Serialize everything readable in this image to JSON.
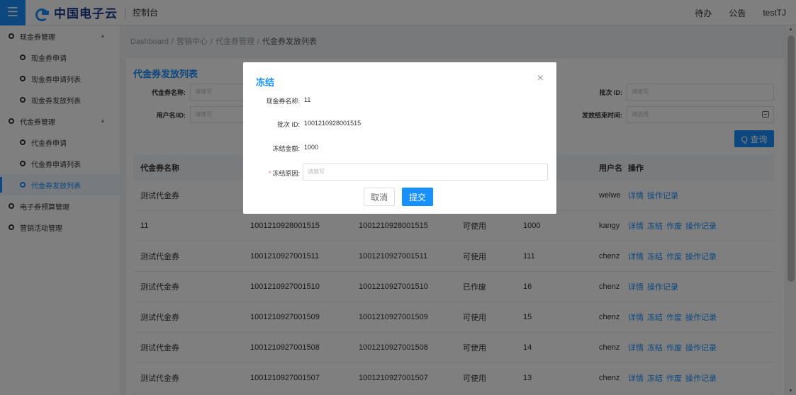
{
  "topbar": {
    "logo": "中国电子云",
    "title": "控制台",
    "todo": "待办",
    "notice": "公告",
    "user": "testTJ"
  },
  "sidebar": {
    "items": [
      {
        "label": "现金券管理",
        "level": 1,
        "caret": "▲",
        "active": false
      },
      {
        "label": "现金券申请",
        "level": 2,
        "active": false
      },
      {
        "label": "现金券申请列表",
        "level": 2,
        "active": false
      },
      {
        "label": "现金券发放列表",
        "level": 2,
        "active": false
      },
      {
        "label": "代金券管理",
        "level": 1,
        "caret": "▲",
        "active": false
      },
      {
        "label": "代金券申请",
        "level": 2,
        "active": false
      },
      {
        "label": "代金券申请列表",
        "level": 2,
        "active": false
      },
      {
        "label": "代金券发放列表",
        "level": 2,
        "active": true
      },
      {
        "label": "电子券预算管理",
        "level": 1,
        "active": false
      },
      {
        "label": "营销活动管理",
        "level": 1,
        "active": false
      }
    ]
  },
  "breadcrumb": [
    "Dashboard",
    "营销中心",
    "代金券管理",
    "代金券发放列表"
  ],
  "breadcrumb_sep": "/",
  "panel": {
    "title": "代金券发放列表",
    "filters": {
      "name_label": "代金券名称:",
      "name_placeholder": "请填写",
      "user_label": "用户名/ID:",
      "user_placeholder": "请填写",
      "batch_label": "批次 ID:",
      "batch_placeholder": "请填写",
      "end_label": "发放结束时间:",
      "end_placeholder": "请选择"
    },
    "search_button": "Q 查询"
  },
  "table": {
    "headers": {
      "name": "代金券名称",
      "user": "用户名",
      "ops": "操作"
    },
    "rows": [
      {
        "name": "测试代金券",
        "batch": "",
        "code": "",
        "status": "",
        "amount": "",
        "user": "welwe",
        "ops": [
          "详情",
          "操作记录"
        ]
      },
      {
        "name": "11",
        "batch": "1001210928001515",
        "code": "1001210928001515",
        "status": "可使用",
        "amount": "1000",
        "user": "kangy",
        "ops": [
          "详情",
          "冻结",
          "作废",
          "操作记录"
        ]
      },
      {
        "name": "测试代金券",
        "batch": "1001210927001511",
        "code": "1001210927001511",
        "status": "可使用",
        "amount": "111",
        "user": "chenz",
        "ops": [
          "详情",
          "冻结",
          "作废",
          "操作记录"
        ]
      },
      {
        "name": "测试代金券",
        "batch": "1001210927001510",
        "code": "1001210927001510",
        "status": "已作废",
        "amount": "16",
        "user": "chenz",
        "ops": [
          "详情",
          "操作记录"
        ]
      },
      {
        "name": "测试代金券",
        "batch": "1001210927001509",
        "code": "1001210927001509",
        "status": "可使用",
        "amount": "15",
        "user": "chenz",
        "ops": [
          "详情",
          "冻结",
          "作废",
          "操作记录"
        ]
      },
      {
        "name": "测试代金券",
        "batch": "1001210927001508",
        "code": "1001210927001508",
        "status": "可使用",
        "amount": "14",
        "user": "chenz",
        "ops": [
          "详情",
          "冻结",
          "作废",
          "操作记录"
        ]
      },
      {
        "name": "测试代金券",
        "batch": "1001210927001507",
        "code": "1001210927001507",
        "status": "可使用",
        "amount": "13",
        "user": "chenz",
        "ops": [
          "详情",
          "冻结",
          "作废",
          "操作记录"
        ]
      }
    ]
  },
  "dialog": {
    "title": "冻结",
    "close": "×",
    "fields": {
      "cash_name_label": "现金券名称:",
      "cash_name_value": "11",
      "batch_label": "批次 ID:",
      "batch_value": "1001210928001515",
      "amount_label": "冻结金额:",
      "amount_value": "1000",
      "reason_required": "*",
      "reason_label": "冻结原因:",
      "reason_placeholder": "请填写"
    },
    "cancel": "取消",
    "submit": "提交"
  },
  "colors": {
    "accent": "#1890ff",
    "danger": "#f56c6c"
  },
  "icons": {
    "menu": "menu-icon",
    "sidebar": "dashboard-icon",
    "calendar": "calendar-icon",
    "close": "close-icon"
  }
}
